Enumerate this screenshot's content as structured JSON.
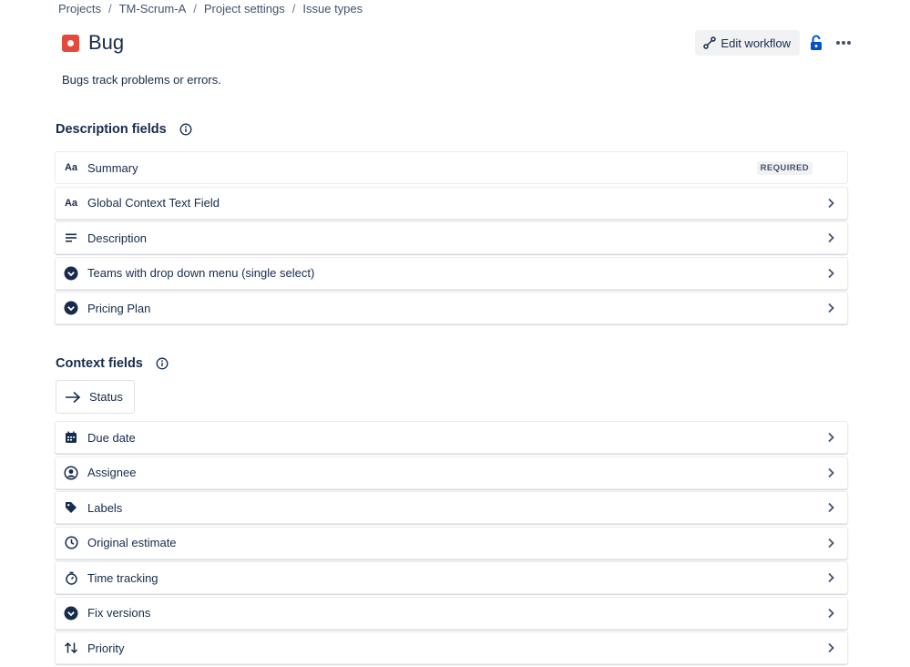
{
  "breadcrumb": [
    "Projects",
    "TM-Scrum-A",
    "Project settings",
    "Issue types"
  ],
  "header": {
    "title": "Bug",
    "icon": "bug-icon",
    "icon_color": "#e5493a",
    "edit_workflow_label": "Edit workflow",
    "lock_icon_color": "#0052cc"
  },
  "subtitle": "Bugs track problems or errors.",
  "description_section": {
    "heading": "Description fields",
    "fields": [
      {
        "label": "Summary",
        "icon": "text-field-icon",
        "badge": "REQUIRED"
      },
      {
        "label": "Global Context Text Field",
        "icon": "text-field-icon"
      },
      {
        "label": "Description",
        "icon": "paragraph-icon"
      },
      {
        "label": "Teams with drop down menu (single select)",
        "icon": "dropdown-icon"
      },
      {
        "label": "Pricing Plan",
        "icon": "dropdown-icon"
      }
    ]
  },
  "context_section": {
    "heading": "Context fields",
    "status_label": "Status",
    "fields": [
      {
        "label": "Due date",
        "icon": "calendar-icon"
      },
      {
        "label": "Assignee",
        "icon": "person-icon"
      },
      {
        "label": "Labels",
        "icon": "tag-icon"
      },
      {
        "label": "Original estimate",
        "icon": "clock-icon"
      },
      {
        "label": "Time tracking",
        "icon": "stopwatch-icon"
      },
      {
        "label": "Fix versions",
        "icon": "dropdown-icon"
      },
      {
        "label": "Priority",
        "icon": "priority-icon"
      }
    ]
  },
  "text_field_glyph": "Aa"
}
